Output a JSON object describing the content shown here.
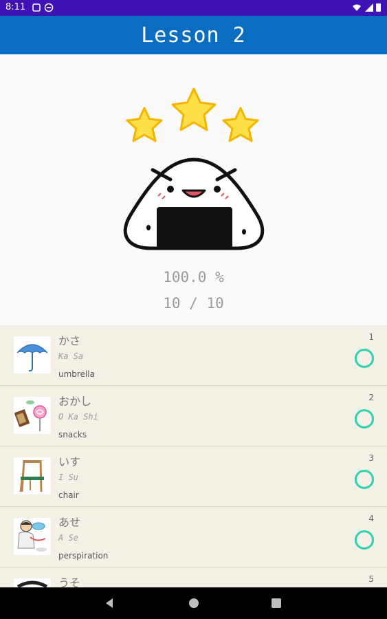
{
  "status_bar": {
    "time": "8:11"
  },
  "app_bar": {
    "title": "Lesson 2"
  },
  "result": {
    "percent": "100.0 %",
    "score": "10 / 10",
    "stars": 3
  },
  "items": [
    {
      "kana": "かさ",
      "romaji": "Ka Sa",
      "meaning": "umbrella",
      "number": "1",
      "image": "umbrella-icon"
    },
    {
      "kana": "おかし",
      "romaji": "O Ka Shi",
      "meaning": "snacks",
      "number": "2",
      "image": "snacks-icon"
    },
    {
      "kana": "いす",
      "romaji": "I Su",
      "meaning": "chair",
      "number": "3",
      "image": "chair-icon"
    },
    {
      "kana": "あせ",
      "romaji": "A Se",
      "meaning": "perspiration",
      "number": "4",
      "image": "perspiration-icon"
    },
    {
      "kana": "うそ",
      "romaji": "",
      "meaning": "",
      "number": "5",
      "image": "lie-icon"
    }
  ],
  "colors": {
    "status_bar": "#3f12b5",
    "app_bar": "#0a6dbf",
    "list_bg": "#f4f0e6",
    "check": "#2fd1b0",
    "star": "#fde047"
  }
}
